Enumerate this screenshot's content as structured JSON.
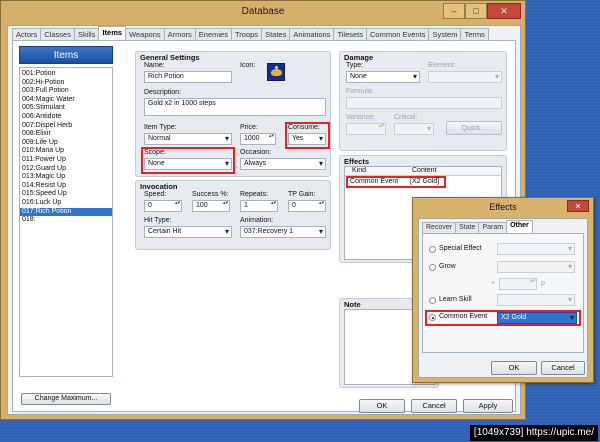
{
  "window": {
    "title": "Database",
    "minimize": "–",
    "maximize": "□",
    "close": "✕"
  },
  "tabs": [
    "Actors",
    "Classes",
    "Skills",
    "Items",
    "Weapons",
    "Armors",
    "Enemies",
    "Troops",
    "States",
    "Animations",
    "Tilesets",
    "Common Events",
    "System",
    "Terms"
  ],
  "items_panel": {
    "header": "Items",
    "items": [
      "001:Potion",
      "002:Hi-Potion",
      "003:Full Potion",
      "004:Magic Water",
      "005:Stimulant",
      "006:Antidote",
      "007:Dispel Herb",
      "008:Elixir",
      "009:Life Up",
      "010:Mana Up",
      "011:Power Up",
      "012:Guard Up",
      "013:Magic Up",
      "014:Resist Up",
      "015:Speed Up",
      "016:Luck Up",
      "017:Rich Potion",
      "018:"
    ],
    "selected_index": 16,
    "change_max": "Change Maximum..."
  },
  "general": {
    "title": "General Settings",
    "name_label": "Name:",
    "name": "Rich Potion",
    "icon_label": "Icon:",
    "desc_label": "Description:",
    "description": "Gold x2 in 1000 steps",
    "type_label": "Item Type:",
    "type": "Normal",
    "price_label": "Price:",
    "price": "1000",
    "consume_label": "Consume:",
    "consume": "Yes",
    "scope_label": "Scope:",
    "scope": "None",
    "occasion_label": "Occasion:",
    "occasion": "Always"
  },
  "invocation": {
    "title": "Invocation",
    "speed_label": "Speed:",
    "speed": "0",
    "success_label": "Success %:",
    "success": "100",
    "repeats_label": "Repeats:",
    "repeats": "1",
    "tp_label": "TP Gain:",
    "tp": "0",
    "hit_label": "Hit Type:",
    "hit": "Certain Hit",
    "anim_label": "Animation:",
    "anim": "037:Recovery 1"
  },
  "damage": {
    "title": "Damage",
    "type_label": "Type:",
    "type": "None",
    "element_label": "Element:",
    "formula_label": "Formula:",
    "variance_label": "Variance:",
    "critical_label": "Critical:",
    "quick": "Quick..."
  },
  "effects": {
    "title": "Effects",
    "kind_header": "Kind",
    "content_header": "Content",
    "row_kind": "Common Event",
    "row_content": "[X2 Gold]"
  },
  "note": {
    "title": "Note"
  },
  "buttons": {
    "ok": "OK",
    "cancel": "Cancel",
    "apply": "Apply"
  },
  "dialog": {
    "title": "Effects",
    "close": "✕",
    "tabs": [
      "Recover",
      "State",
      "Param",
      "Other"
    ],
    "special_label": "Special Effect",
    "grow_label": "Grow",
    "plus": "+",
    "p": "p",
    "learn_label": "Learn Skill",
    "common_label": "Common Event",
    "common_value": "X2 Gold",
    "ok": "OK",
    "cancel": "Cancel"
  },
  "watermark": "[1049x739] https://upic.me/"
}
